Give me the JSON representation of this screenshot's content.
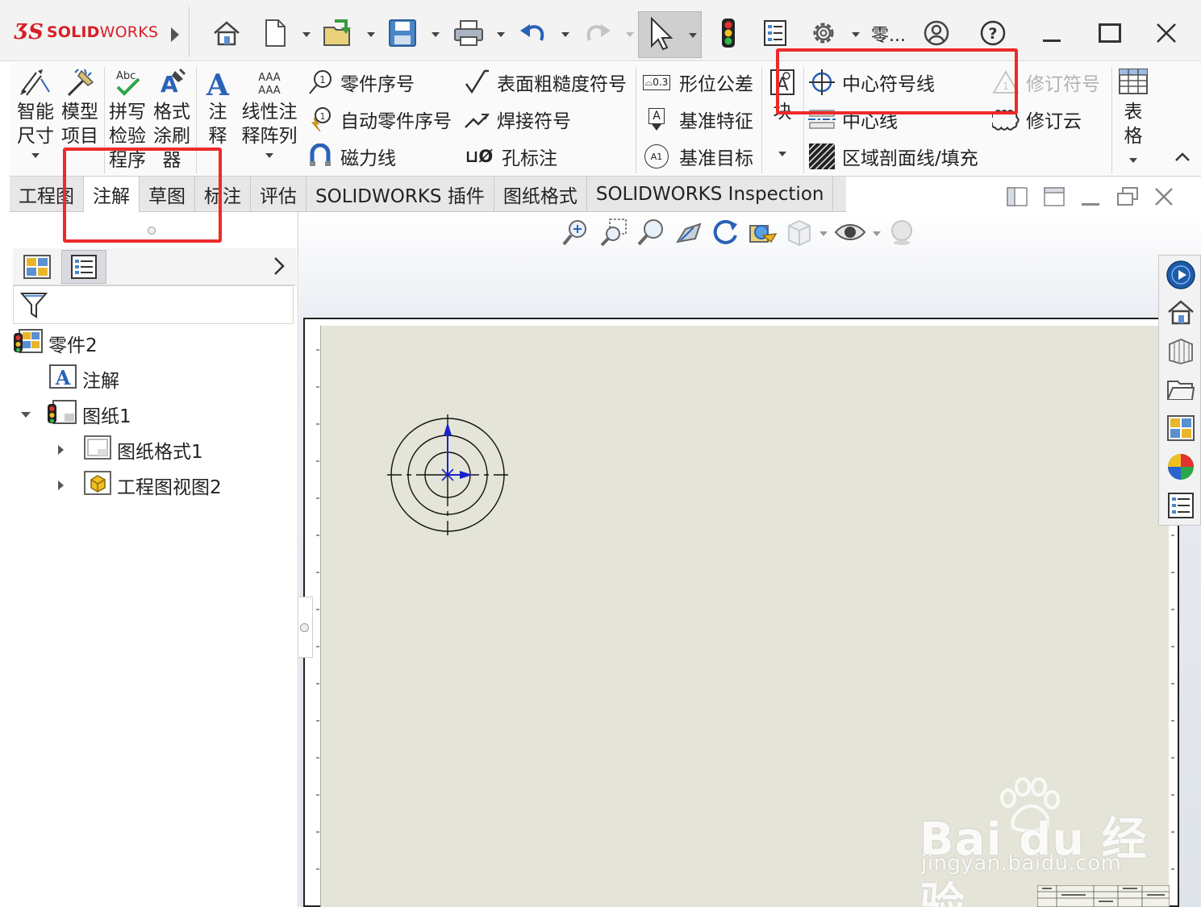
{
  "app": {
    "logo_mark": "ƷS",
    "logo_bold": "SOLID",
    "logo_light": "WORKS",
    "title_truncated": "零..."
  },
  "ribbon": {
    "smart_dimension": [
      "智能",
      "尺寸"
    ],
    "model_items": [
      "模型",
      "项目"
    ],
    "spell_check": [
      "拼写",
      "检验",
      "程序"
    ],
    "format_painter": [
      "格式",
      "涂刷",
      "器"
    ],
    "note": [
      "注",
      "释"
    ],
    "linear_note_pattern": [
      "线性注",
      "释阵列"
    ],
    "col1": [
      {
        "icon": "balloon-icon",
        "label": "零件序号"
      },
      {
        "icon": "auto-balloon-icon",
        "label": "自动零件序号"
      },
      {
        "icon": "magnetic-line-icon",
        "label": "磁力线"
      }
    ],
    "col2": [
      {
        "icon": "surface-finish-icon",
        "label": "表面粗糙度符号"
      },
      {
        "icon": "weld-symbol-icon",
        "label": "焊接符号"
      },
      {
        "icon": "hole-callout-icon",
        "label": "孔标注"
      }
    ],
    "col3": [
      {
        "icon": "geometric-tolerance-icon",
        "label": "形位公差"
      },
      {
        "icon": "datum-feature-icon",
        "label": "基准特征"
      },
      {
        "icon": "datum-target-icon",
        "label": "基准目标"
      }
    ],
    "block_label": "块",
    "col4": [
      {
        "icon": "center-mark-icon",
        "label": "中心符号线"
      },
      {
        "icon": "centerline-icon",
        "label": "中心线"
      },
      {
        "icon": "area-hatch-icon",
        "label": "区域剖面线/填充"
      }
    ],
    "col5": [
      {
        "icon": "revision-symbol-icon",
        "label": "修订符号",
        "disabled": true
      },
      {
        "icon": "revision-cloud-icon",
        "label": "修订云",
        "disabled": false
      }
    ],
    "tables": [
      "表",
      "格"
    ],
    "gtol_badge": "⌓0.3",
    "hole_badge": "⊔Ø",
    "datum_badge": "A",
    "datum_target_badge": "A1"
  },
  "tabs": [
    {
      "label": "工程图",
      "active": false
    },
    {
      "label": "注解",
      "active": true
    },
    {
      "label": "草图",
      "active": false
    },
    {
      "label": "标注",
      "active": false
    },
    {
      "label": "评估",
      "active": false
    },
    {
      "label": "SOLIDWORKS 插件",
      "active": false
    },
    {
      "label": "图纸格式",
      "active": false
    },
    {
      "label": "SOLIDWORKS Inspection",
      "active": false
    }
  ],
  "tree": {
    "root": "零件2",
    "annotations": "注解",
    "sheet": "图纸1",
    "sheet_format": "图纸格式1",
    "drawing_view": "工程图视图2"
  },
  "colors": {
    "brand_red": "#d71f26",
    "highlight_red": "#ee2a2a",
    "sheet_bg": "#e5e4d8",
    "arrow_blue": "#1a22c9"
  },
  "watermark": {
    "brand": "Bai du 经验",
    "url": "jingyan.baidu.com"
  }
}
